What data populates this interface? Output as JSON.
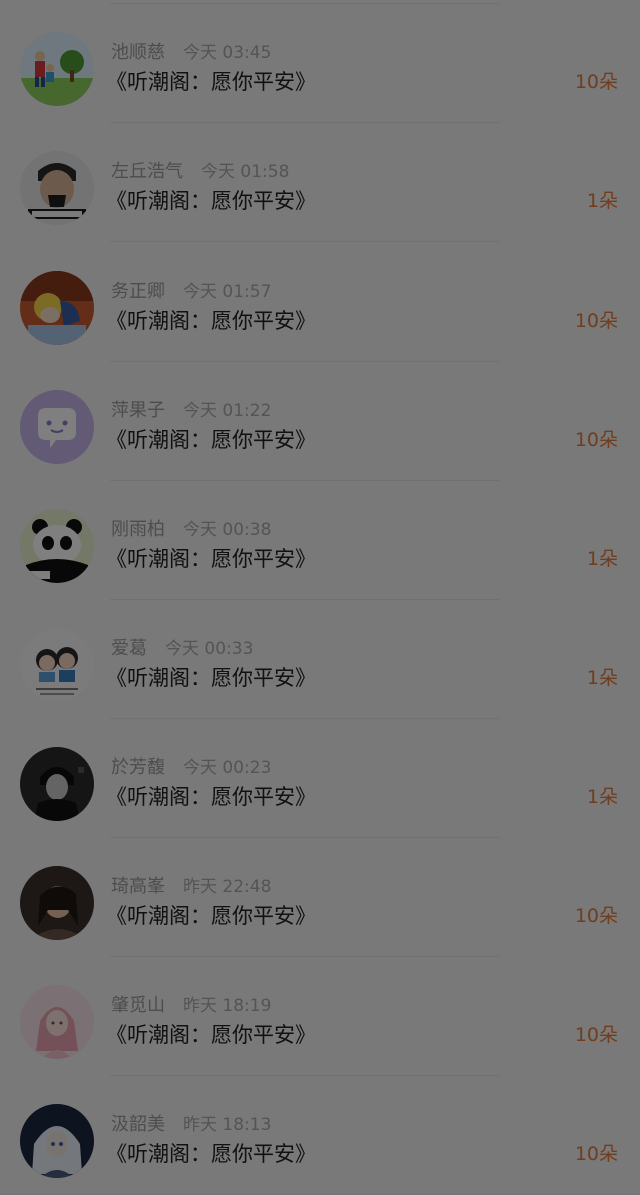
{
  "gift_list": {
    "items": [
      {
        "sender": "池顺慈",
        "time": "今天 03:45",
        "gift": "《听潮阁：愿你平安》",
        "amount": "10朵",
        "avatar_icon": "cartoon-family-avatar"
      },
      {
        "sender": "左丘浩气",
        "time": "今天 01:58",
        "gift": "《听潮阁：愿你平安》",
        "amount": "1朵",
        "avatar_icon": "man-with-mask-avatar"
      },
      {
        "sender": "务正卿",
        "time": "今天 01:57",
        "gift": "《听潮阁：愿你平安》",
        "amount": "10朵",
        "avatar_icon": "anime-couple-avatar"
      },
      {
        "sender": "萍果子",
        "time": "今天 01:22",
        "gift": "《听潮阁：愿你平安》",
        "amount": "10朵",
        "avatar_icon": "purple-chat-bubble-avatar"
      },
      {
        "sender": "刚雨柏",
        "time": "今天 00:38",
        "gift": "《听潮阁：愿你平安》",
        "amount": "1朵",
        "avatar_icon": "panda-avatar"
      },
      {
        "sender": "爱葛",
        "time": "今天 00:33",
        "gift": "《听潮阁：愿你平安》",
        "amount": "1朵",
        "avatar_icon": "cartoon-kids-avatar"
      },
      {
        "sender": "於芳馥",
        "time": "今天 00:23",
        "gift": "《听潮阁：愿你平安》",
        "amount": "1朵",
        "avatar_icon": "dark-anime-boy-avatar"
      },
      {
        "sender": "琦高峯",
        "time": "昨天 22:48",
        "gift": "《听潮阁：愿你平安》",
        "amount": "10朵",
        "avatar_icon": "woman-portrait-avatar"
      },
      {
        "sender": "肇觅山",
        "time": "昨天 18:19",
        "gift": "《听潮阁：愿你平安》",
        "amount": "10朵",
        "avatar_icon": "pink-anime-girl-avatar"
      },
      {
        "sender": "汲韶美",
        "time": "昨天 18:13",
        "gift": "《听潮阁：愿你平安》",
        "amount": "10朵",
        "avatar_icon": "white-hair-anime-avatar"
      }
    ]
  },
  "colors": {
    "amount": "#e07a3c",
    "overlay": "rgba(0,0,0,0.5)",
    "background": "#f3f3f3"
  }
}
